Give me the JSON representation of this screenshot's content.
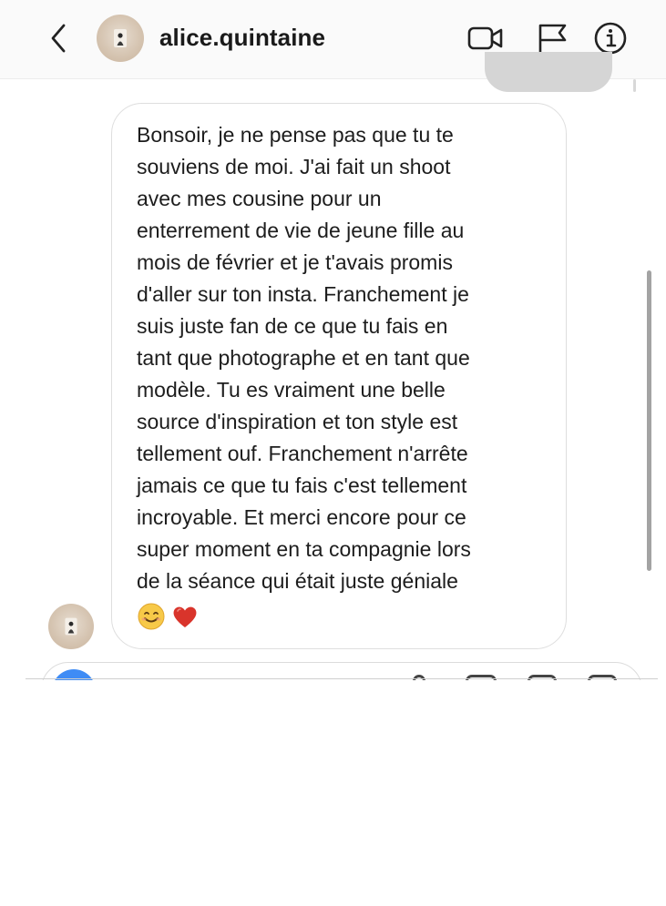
{
  "header": {
    "username": "alice.quintaine",
    "icons": [
      "chevron-left-icon",
      "video-camera-icon",
      "flag-icon",
      "info-icon"
    ]
  },
  "message": {
    "lines": [
      "Bonsoir, je ne pense pas que tu te",
      "souviens de moi. J'ai fait un shoot",
      "avec mes cousine pour un",
      "enterrement de vie de jeune fille au",
      "mois de février et je t'avais promis",
      "d'aller sur ton insta. Franchement je",
      "suis juste fan de ce que tu fais en",
      "tant que photographe et en tant que",
      "modèle. Tu es vraiment une belle",
      "source d'inspiration et ton style est",
      "tellement ouf. Franchement n'arrête",
      "jamais ce que tu fais c'est tellement",
      "incroyable. Et merci encore pour ce",
      "super moment en ta compagnie lors",
      "de la séance qui était juste géniale"
    ],
    "emojis": [
      "smiling-face-emoji",
      "red-heart-emoji"
    ]
  },
  "composer": {
    "icons": [
      "camera-icon",
      "microphone-icon",
      "gallery-icon",
      "sticker-icon",
      "plus-icon"
    ]
  },
  "colors": {
    "accent": "#3f8cf5",
    "bubble_border": "#dedede",
    "sent_bubble": "#d5d5d5",
    "heart": "#d9342b",
    "emoji_face": "#f7c948"
  }
}
